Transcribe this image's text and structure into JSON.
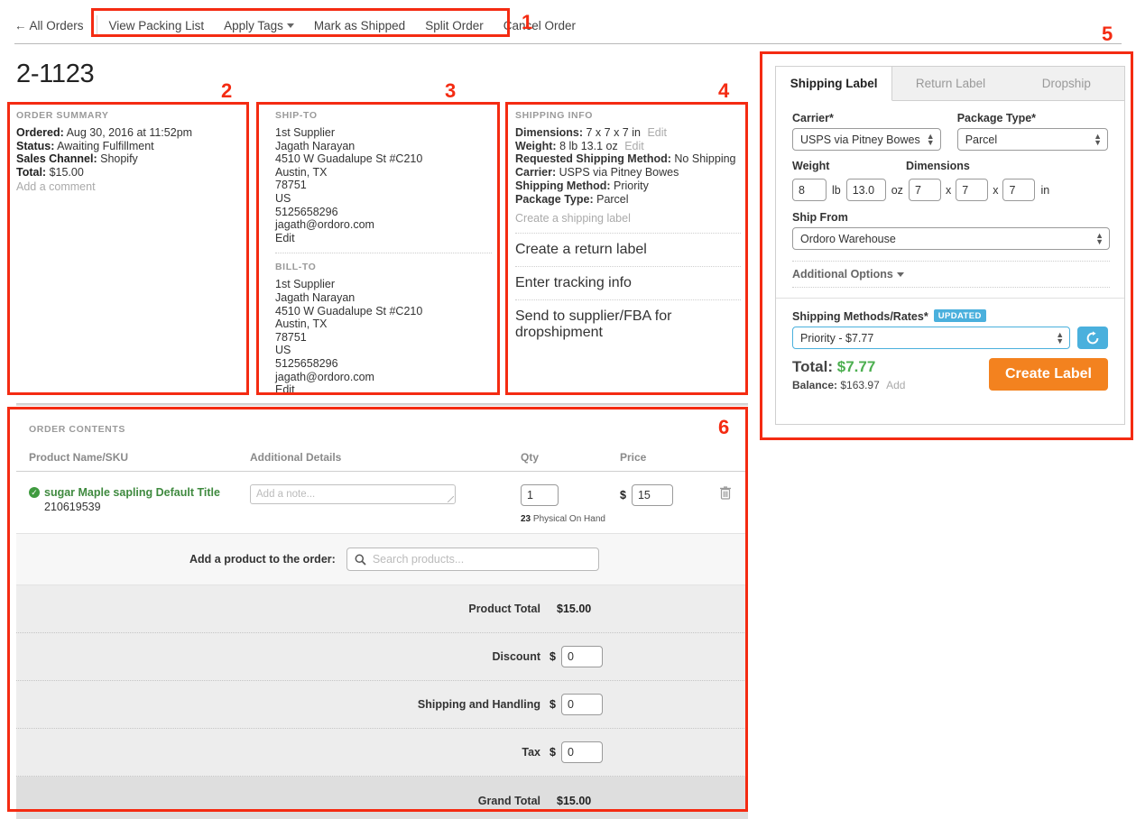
{
  "topbar": {
    "back_label": "← All Orders",
    "actions": [
      {
        "label": "View Packing List",
        "caret": false
      },
      {
        "label": "Apply Tags",
        "caret": true
      },
      {
        "label": "Mark as Shipped",
        "caret": false
      },
      {
        "label": "Split Order",
        "caret": false
      },
      {
        "label": "Cancel Order",
        "caret": false
      }
    ]
  },
  "page": {
    "title": "2-1123"
  },
  "order_summary": {
    "heading": "ORDER SUMMARY",
    "ordered_label": "Ordered:",
    "ordered_value": "Aug 30, 2016 at 11:52pm",
    "status_label": "Status:",
    "status_value": "Awaiting Fulfillment",
    "channel_label": "Sales Channel:",
    "channel_value": "Shopify",
    "total_label": "Total:",
    "total_value": "$15.00",
    "add_comment": "Add a comment"
  },
  "ship_to": {
    "heading": "SHIP-TO",
    "lines": [
      "1st Supplier",
      "Jagath Narayan",
      "4510 W Guadalupe St #C210",
      "Austin, TX",
      "78751",
      "US",
      "5125658296",
      "jagath@ordoro.com"
    ],
    "edit": "Edit"
  },
  "bill_to": {
    "heading": "BILL-TO",
    "lines": [
      "1st Supplier",
      "Jagath Narayan",
      "4510 W Guadalupe St #C210",
      "Austin, TX",
      "78751",
      "US",
      "5125658296",
      "jagath@ordoro.com"
    ],
    "edit": "Edit"
  },
  "shipping_info": {
    "heading": "SHIPPING INFO",
    "dimensions_label": "Dimensions:",
    "dimensions_value": "7 x 7 x 7 in",
    "dimensions_edit": "Edit",
    "weight_label": "Weight:",
    "weight_value": "8 lb 13.1 oz",
    "weight_edit": "Edit",
    "requested_label": "Requested Shipping Method:",
    "requested_value": "No Shipping",
    "carrier_label": "Carrier:",
    "carrier_value": "USPS via Pitney Bowes",
    "method_label": "Shipping Method:",
    "method_value": "Priority",
    "package_label": "Package Type:",
    "package_value": "Parcel",
    "actions": [
      "Create a shipping label",
      "Create a return label",
      "Enter tracking info",
      "Send to supplier/FBA for dropshipment"
    ]
  },
  "label_card": {
    "tabs": [
      {
        "label": "Shipping Label",
        "active": true
      },
      {
        "label": "Return Label",
        "active": false
      },
      {
        "label": "Dropship",
        "active": false
      }
    ],
    "carrier_label": "Carrier*",
    "carrier_value": "USPS via Pitney Bowes",
    "package_type_label": "Package Type*",
    "package_type_value": "Parcel",
    "weight_label": "Weight",
    "weight_lb": "8",
    "unit_lb": "lb",
    "weight_oz": "13.0",
    "unit_oz": "oz",
    "dimensions_label": "Dimensions",
    "dim_l": "7",
    "dim_w": "7",
    "dim_h": "7",
    "dim_x1": "x",
    "dim_x2": "x",
    "unit_in": "in",
    "ship_from_label": "Ship From",
    "ship_from_value": "Ordoro Warehouse",
    "additional_options": "Additional Options",
    "rates_label": "Shipping Methods/Rates*",
    "rates_badge": "UPDATED",
    "rates_value": "Priority - $7.77",
    "total_label": "Total:",
    "total_value": "$7.77",
    "balance_label": "Balance:",
    "balance_value": "$163.97",
    "balance_add": "Add",
    "create_label_button": "Create Label",
    "accent_blue": "#4ab0dd",
    "accent_orange": "#f3821f",
    "total_green": "#4caf50"
  },
  "order_contents": {
    "heading": "ORDER CONTENTS",
    "columns": [
      "Product Name/SKU",
      "Additional Details",
      "Qty",
      "Price"
    ],
    "rows": [
      {
        "product_name": "sugar Maple sapling Default Title",
        "sku": "210619539",
        "note_placeholder": "Add a note...",
        "qty": "1",
        "on_hand_count": "23",
        "on_hand_label": "Physical On Hand",
        "currency": "$",
        "price": "15"
      }
    ],
    "add_product_label": "Add a product to the order:",
    "search_placeholder": "Search products...",
    "totals": [
      {
        "label": "Product Total",
        "value": "$15.00",
        "editable": false
      },
      {
        "label": "Discount",
        "value": "0",
        "editable": true,
        "currency": "$"
      },
      {
        "label": "Shipping and Handling",
        "value": "0",
        "editable": true,
        "currency": "$"
      },
      {
        "label": "Tax",
        "value": "0",
        "editable": true,
        "currency": "$"
      },
      {
        "label": "Grand Total",
        "value": "$15.00",
        "editable": false
      }
    ]
  },
  "annotations": {
    "color": "#f42b12",
    "numbers": [
      "1",
      "2",
      "3",
      "4",
      "5",
      "6"
    ]
  }
}
